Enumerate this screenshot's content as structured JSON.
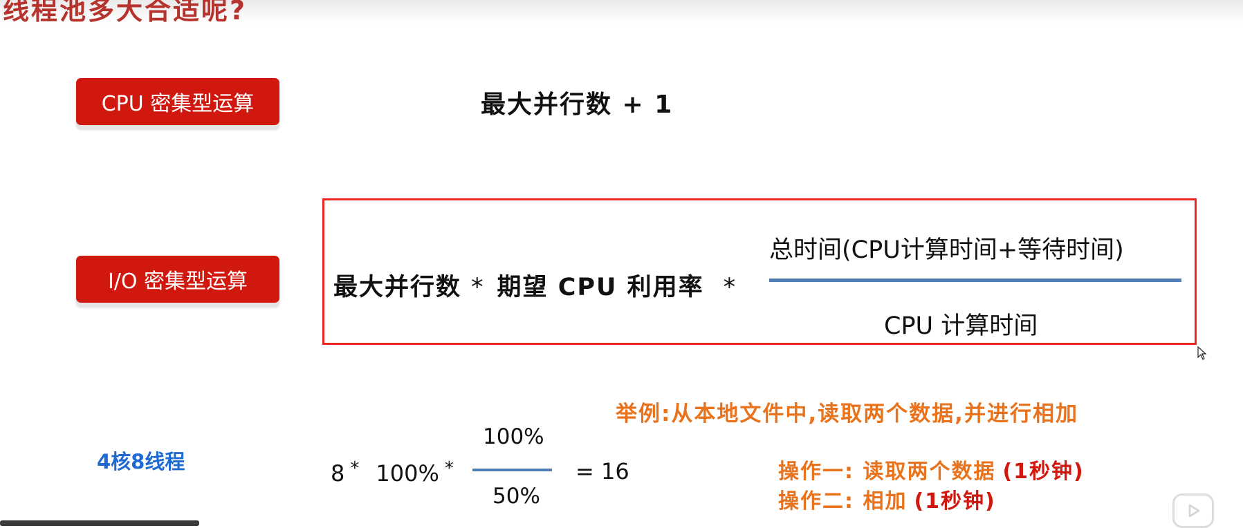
{
  "title": "线程池多大合适呢?",
  "cpu_section": {
    "label": "CPU 密集型运算",
    "formula": "最大并行数 + 1"
  },
  "io_section": {
    "label": "I/O 密集型运算",
    "formula_left_part1": "最大并行数",
    "formula_op1": "*",
    "formula_left_part2": "期望 CPU 利用率",
    "formula_op2": "*",
    "fraction_numerator": "总时间(CPU计算时间+等待时间)",
    "fraction_denominator": "CPU 计算时间"
  },
  "example": {
    "title": "举例:从本地文件中,读取两个数据,并进行相加",
    "cores_label": "4核8线程",
    "calc_a": "8",
    "calc_b": "100%",
    "calc_star": "*",
    "calc_frac_num": "100%",
    "calc_frac_den": "50%",
    "calc_result": "= 16",
    "op1_text": "操作一: 读取两个数据",
    "op1_duration": "(1秒钟)",
    "op2_text": "操作二: 相加",
    "op2_duration": "(1秒钟)"
  },
  "colors": {
    "title": "#b5322d",
    "label_bg": "#d0180f",
    "box_border": "#e8261e",
    "fraction_line": "#4f7cb3",
    "example_orange": "#e8731c",
    "duration_red": "#d0180f",
    "cores_blue": "#1f6ad1"
  },
  "icons": [
    "cursor-icon",
    "play-icon"
  ]
}
